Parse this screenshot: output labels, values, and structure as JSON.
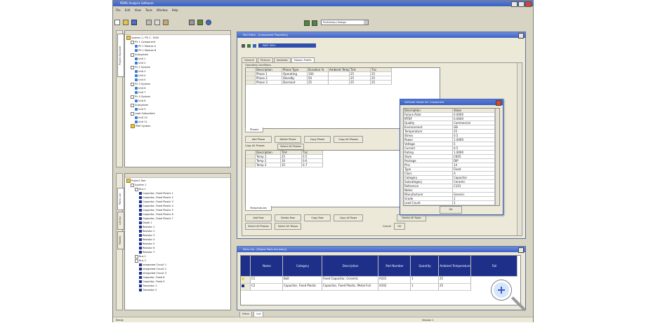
{
  "app": {
    "title": "PEMS Analysis Software",
    "status_text": "Ready",
    "status_right": "Session 1"
  },
  "menu": [
    "File",
    "Edit",
    "View",
    "Tools",
    "Window",
    "Help"
  ],
  "toolbar": {
    "combo_value": "Preliminary Design"
  },
  "left_top": {
    "rows": [
      {
        "indent": 0,
        "icon": "folder",
        "text": "System 1 / PV 1 - RUN"
      },
      {
        "indent": 1,
        "icon": "plus",
        "text": "PV 1 Component"
      },
      {
        "indent": 2,
        "icon": "node",
        "text": "PV 1 Module A"
      },
      {
        "indent": 2,
        "icon": "node",
        "text": "PV 1 Module B"
      },
      {
        "indent": 1,
        "icon": "plus",
        "text": "Subsystem"
      },
      {
        "indent": 2,
        "icon": "node",
        "text": "Unit 1"
      },
      {
        "indent": 2,
        "icon": "node",
        "text": "Unit 2"
      },
      {
        "indent": 1,
        "icon": "plus",
        "text": "PV 2 System"
      },
      {
        "indent": 2,
        "icon": "node",
        "text": "Unit 3"
      },
      {
        "indent": 2,
        "icon": "node",
        "text": "Unit 4"
      },
      {
        "indent": 2,
        "icon": "node",
        "text": "Unit 5"
      },
      {
        "indent": 1,
        "icon": "plus",
        "text": "PV 3 System"
      },
      {
        "indent": 2,
        "icon": "node",
        "text": "Unit 6"
      },
      {
        "indent": 2,
        "icon": "node",
        "text": "Unit 7"
      },
      {
        "indent": 1,
        "icon": "plus",
        "text": "PV 4 System"
      },
      {
        "indent": 2,
        "icon": "node",
        "text": "Unit 8"
      },
      {
        "indent": 1,
        "icon": "plus",
        "text": "Subsystem"
      },
      {
        "indent": 2,
        "icon": "node",
        "text": "Unit 9"
      },
      {
        "indent": 1,
        "icon": "plus",
        "text": "Load Subsystem"
      },
      {
        "indent": 2,
        "icon": "node",
        "text": "Unit 10"
      },
      {
        "indent": 2,
        "icon": "node",
        "text": "Unit 11"
      },
      {
        "indent": 1,
        "icon": "folder",
        "text": "PMS System"
      }
    ]
  },
  "left_bottom": {
    "rows": [
      {
        "indent": 0,
        "icon": "folder",
        "text": "Project Tree"
      },
      {
        "indent": 1,
        "icon": "plus",
        "text": "System 1"
      },
      {
        "indent": 2,
        "icon": "plus",
        "text": "Bus 1"
      },
      {
        "indent": 3,
        "icon": "sq",
        "text": "Capacitor, Fixed Plastic 1"
      },
      {
        "indent": 3,
        "icon": "sq",
        "text": "Capacitor, Fixed Plastic 2"
      },
      {
        "indent": 3,
        "icon": "sq",
        "text": "Capacitor, Fixed Plastic 3"
      },
      {
        "indent": 3,
        "icon": "sq",
        "text": "Capacitor, Fixed Plastic 4"
      },
      {
        "indent": 3,
        "icon": "sq",
        "text": "Capacitor, Fixed Plastic 5"
      },
      {
        "indent": 3,
        "icon": "sq",
        "text": "Capacitor, Fixed Plastic 6"
      },
      {
        "indent": 3,
        "icon": "sq",
        "text": "Capacitor, Fixed Plastic 7"
      },
      {
        "indent": 3,
        "icon": "sq",
        "text": "Diode 1"
      },
      {
        "indent": 3,
        "icon": "sq",
        "text": "Resistor 1"
      },
      {
        "indent": 3,
        "icon": "sq",
        "text": "Resistor 2"
      },
      {
        "indent": 3,
        "icon": "sq",
        "text": "Resistor 3"
      },
      {
        "indent": 3,
        "icon": "sq",
        "text": "Resistor 4"
      },
      {
        "indent": 3,
        "icon": "sq",
        "text": "Resistor 5"
      },
      {
        "indent": 3,
        "icon": "sq",
        "text": "Resistor 6"
      },
      {
        "indent": 3,
        "icon": "sq",
        "text": "Resistor 7"
      },
      {
        "indent": 2,
        "icon": "plus",
        "text": "Bus 2"
      },
      {
        "indent": 2,
        "icon": "plus",
        "text": "Bus 3"
      },
      {
        "indent": 3,
        "icon": "sq",
        "text": "Integrated Circuit 1"
      },
      {
        "indent": 3,
        "icon": "sq",
        "text": "Integrated Circuit 2"
      },
      {
        "indent": 3,
        "icon": "sq",
        "text": "Integrated Circuit 3"
      },
      {
        "indent": 3,
        "icon": "sq",
        "text": "Capacitor, Fixed 8"
      },
      {
        "indent": 3,
        "icon": "sq",
        "text": "Capacitor, Fixed 9"
      },
      {
        "indent": 3,
        "icon": "sq",
        "text": "Transistor 1"
      },
      {
        "indent": 3,
        "icon": "sq",
        "text": "Transistor 2"
      }
    ]
  },
  "side_tabs_top": [
    "Project Explorer"
  ],
  "side_tabs_bottom": [
    "Parts List",
    "Library",
    "Models"
  ],
  "mdi1": {
    "title": "Part Editor - [Component Properties]",
    "part_label": "PART 0001",
    "tabs": [
      "General",
      "Pictures",
      "Variables",
      "Mission Profile"
    ],
    "group_title": "Operating Conditions",
    "table1": {
      "headers": [
        "Description",
        "Phase Type",
        "Duration %",
        "Ambient Temp",
        "Tint",
        "Tnc"
      ],
      "rows": [
        [
          "Phase 1",
          "Operating",
          "100",
          "",
          "25",
          "25"
        ],
        [
          "Phase 2",
          "Standby",
          "50",
          "",
          "25",
          "25"
        ],
        [
          "Phase 3",
          "Dormant",
          "25",
          "",
          "25",
          "25"
        ]
      ]
    },
    "subtab1": [
      "Phases"
    ],
    "buttons1": [
      "Add Phase",
      "Delete Phase",
      "Copy Phase",
      "Copy All Phases"
    ],
    "group2_title": "Copy All Phases",
    "group2_btn": "Select All Phases",
    "table2": {
      "headers": [
        "Description",
        "Tint",
        "Tnc"
      ],
      "rows": [
        [
          "Temp 1",
          "25",
          "0.5"
        ],
        [
          "Temp 2",
          "30",
          "0.6"
        ],
        [
          "Temp 3",
          "35",
          "0.7"
        ]
      ]
    },
    "subtab2": [
      "Temperatures"
    ],
    "buttons2": [
      "Add Row",
      "Delete Row",
      "Copy Row",
      "Copy All Rows",
      "Delete All Rows"
    ],
    "buttons3": [
      "Select All Phases",
      "Select All Temps"
    ],
    "cancel_label": "Cancel",
    "ok_label": "OK"
  },
  "dialog": {
    "title": "Attribute Values for: Component",
    "headers": [
      "Description",
      "Value"
    ],
    "rows": [
      [
        "Failure Rate",
        "0.0000"
      ],
      [
        "MTBF",
        "0.0000"
      ],
      [
        "Quality",
        "Commercial"
      ],
      [
        "Environment",
        "GB"
      ],
      [
        "Temperature",
        "25"
      ],
      [
        "Stress",
        "0.5"
      ],
      [
        "Power",
        "1.0000"
      ],
      [
        "Voltage",
        "5"
      ],
      [
        "Current",
        "0.5"
      ],
      [
        "Rating",
        "1.0000"
      ],
      [
        "Style",
        "CK05"
      ],
      [
        "Package",
        "DIP"
      ],
      [
        "Pins",
        "14"
      ],
      [
        "Type",
        "Fixed"
      ],
      [
        "Class",
        "A"
      ],
      [
        "Category",
        "Capacitor"
      ],
      [
        "Subcategory",
        "Ceramic"
      ],
      [
        "Reference",
        "C101"
      ],
      [
        "Notes",
        ""
      ],
      [
        "Manufacturer",
        "Generic"
      ],
      [
        "Grade",
        "1"
      ],
      [
        "Lead Count",
        "2"
      ]
    ],
    "ok_label": "OK"
  },
  "mdi2": {
    "title": "Parts List - [Project Parts Summary]",
    "headers": [
      "",
      "Name",
      "Category",
      "Description",
      "Part Number",
      "Quantity",
      "Ambient Temperature",
      "Fail"
    ],
    "rows": [
      [
        "C1",
        "Bolt",
        "Fixed Capacitor, Ceramic",
        "A101",
        "1",
        "25"
      ],
      [
        "C2",
        "Capacitor, Fixed Plastic",
        "Capacitor, Fixed Plastic, Metal Foil",
        "A102",
        "1",
        "25"
      ]
    ],
    "bottom_tabs": [
      "Editor",
      "List"
    ]
  },
  "colors": {
    "accent": "#2f4fb0",
    "title_blue": "#3a5fbf",
    "dark_blue": "#1e2f8a",
    "panel_bg": "#ece9d8"
  }
}
